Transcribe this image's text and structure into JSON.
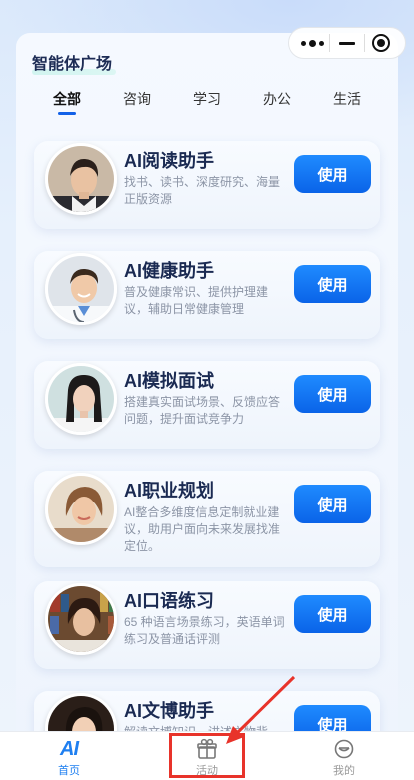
{
  "panel": {
    "title": "智能体广场"
  },
  "tabs": [
    {
      "label": "全部",
      "active": true
    },
    {
      "label": "咨询",
      "active": false
    },
    {
      "label": "学习",
      "active": false
    },
    {
      "label": "办公",
      "active": false
    },
    {
      "label": "生活",
      "active": false
    }
  ],
  "cards": [
    {
      "title": "AI阅读助手",
      "desc": "找书、读书、深度研究、海量正版资源",
      "button": "使用",
      "avatar": "young-man-portrait"
    },
    {
      "title": "AI健康助手",
      "desc": "普及健康常识、提供护理建议，辅助日常健康管理",
      "button": "使用",
      "avatar": "doctor-portrait"
    },
    {
      "title": "AI模拟面试",
      "desc": "搭建真实面试场景、反馈应答问题，提升面试竞争力",
      "button": "使用",
      "avatar": "young-woman-portrait"
    },
    {
      "title": "AI职业规划",
      "desc": "AI整合多维度信息定制就业建议，助用户面向未来发展找准定位。",
      "button": "使用",
      "avatar": "woman-portrait"
    },
    {
      "title": "AI口语练习",
      "desc": "65 种语言场景练习，英语单词练习及普通话评测",
      "button": "使用",
      "avatar": "library-woman-portrait"
    },
    {
      "title": "AI文博助手",
      "desc": "解读文博知识、讲述文物背",
      "button": "使用",
      "avatar": "woman-portrait-2"
    }
  ],
  "tabbar": [
    {
      "label": "首页",
      "icon": "ai-logo-icon",
      "active": true
    },
    {
      "label": "活动",
      "icon": "gift-icon",
      "active": false
    },
    {
      "label": "我的",
      "icon": "smile-icon",
      "active": false
    }
  ],
  "colors": {
    "accent": "#1261e8",
    "button": "#0a63e8",
    "highlight": "#e8332a",
    "title": "#1a2a52"
  }
}
